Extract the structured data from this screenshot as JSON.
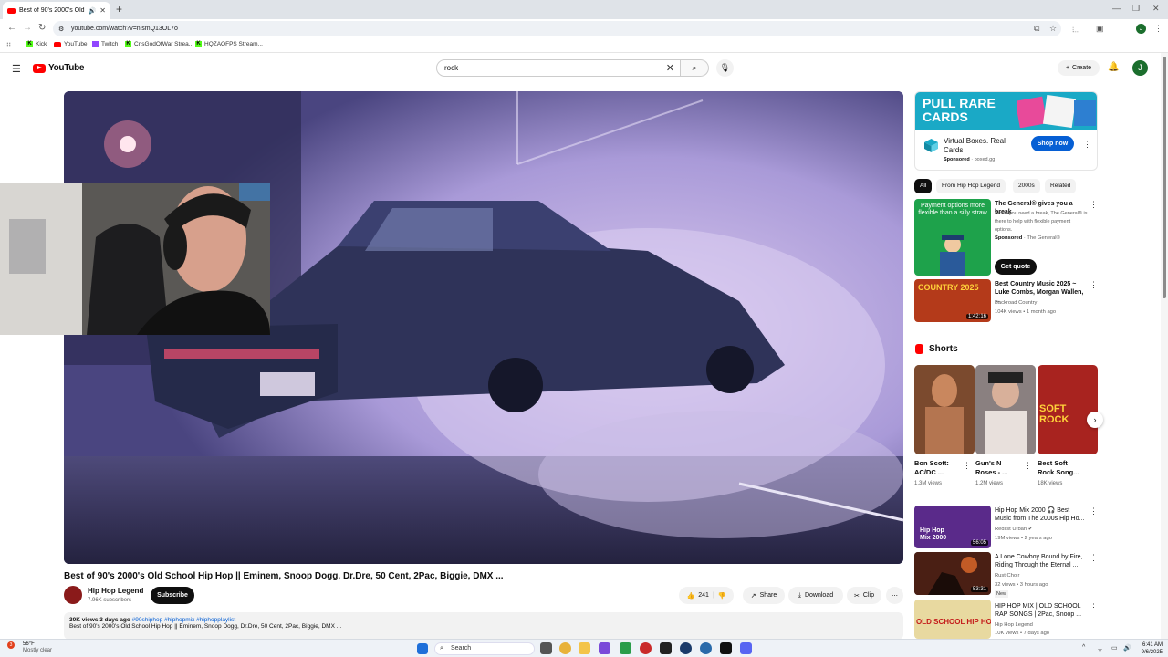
{
  "browser": {
    "tab_title": "Best of 90's 2000's Old Sch",
    "url": "youtube.com/watch?v=nlsmQ13OL7o",
    "bookmarks": [
      "Kick",
      "YouTube",
      "Twitch",
      "CrisGodOfWar Strea...",
      "HQZAOFPS Stream..."
    ]
  },
  "youtube": {
    "logo_text": "YouTube",
    "search_value": "rock",
    "create_label": "Create",
    "profile_initial": "J"
  },
  "video": {
    "title": "Best of 90's 2000's Old School Hip Hop || Eminem, Snoop Dogg, Dr.Dre, 50 Cent, 2Pac, Biggie, DMX ...",
    "channel": "Hip Hop Legend",
    "subscribers": "7.96K subscribers",
    "subscribe_label": "Subscribe",
    "likes": "241",
    "share_label": "Share",
    "download_label": "Download",
    "clip_label": "Clip",
    "views_date": "30K views  3 days ago",
    "hashtags": "#90shiphop #hiphopmix #hiphopplaylist",
    "description_line": "Best of 90's 2000's Old School Hip Hop || Eminem, Snoop Dogg, Dr.Dre, 50 Cent, 2Pac, Biggie, DMX ..."
  },
  "ad_top": {
    "banner_line1": "PULL RARE",
    "banner_line2": "CARDS",
    "title": "Virtual Boxes. Real Cards",
    "sponsored": "Sponsored",
    "domain": "· boxed.gg",
    "cta": "Shop now"
  },
  "chips": [
    "All",
    "From Hip Hop Legend",
    "2000s",
    "Related"
  ],
  "ad_general": {
    "title": "The General® gives you a break",
    "body": "When you need a break, The General® is there to help with flexible payment options.",
    "sponsored": "Sponsored",
    "advertiser": "· The General®",
    "cta": "Get quote",
    "thumb_text": "Payment options more flexible than a silly straw"
  },
  "recommended_top": {
    "title": "Best Country Music 2025 ~ Luke Combs, Morgan Wallen, ...",
    "channel": "Backroad Country",
    "meta": "104K views • 1 month ago",
    "duration": "1:42:16",
    "thumb_text": "COUNTRY 2025"
  },
  "shorts": {
    "heading": "Shorts",
    "items": [
      {
        "title": "Bon Scott: AC/DC ...",
        "views": "1.3M views"
      },
      {
        "title": "Gun's N Roses - ...",
        "views": "1.2M views"
      },
      {
        "title": "Best Soft Rock Song...",
        "views": "18K views",
        "thumb_text": "SOFT ROCK"
      }
    ]
  },
  "recommended": [
    {
      "title": "Hip Hop Mix 2000 🎧 Best Music from The 2000s Hip Ho...",
      "channel": "Redlist Urban",
      "meta": "19M views • 2 years ago",
      "duration": "56:05",
      "thumb_text": "Hip Hop Mix 2000"
    },
    {
      "title": "A Lone Cowboy Bound by Fire, Riding Through the Eternal ...",
      "channel": "Rust Choir",
      "meta": "32 views • 3 hours ago",
      "badge": "New",
      "duration": "53:31"
    },
    {
      "title": "HIP HOP MIX | OLD SCHOOL RAP SONGS | 2Pac, Snoop ...",
      "channel": "Hip Hop Legend",
      "meta": "10K views • 7 days ago",
      "thumb_text": "OLD SCHOOL HIP HOP"
    }
  ],
  "taskbar": {
    "temp": "56°F",
    "weather": "Mostly clear",
    "badge": "3",
    "search_label": "Search",
    "time": "6:41 AM",
    "date": "9/6/2025"
  },
  "colors": {
    "youtube_red": "#ff0000",
    "subscribe_bg": "#0f0f0f",
    "shop_now": "#065fd4",
    "ad_banner": "#1aa9c6"
  }
}
